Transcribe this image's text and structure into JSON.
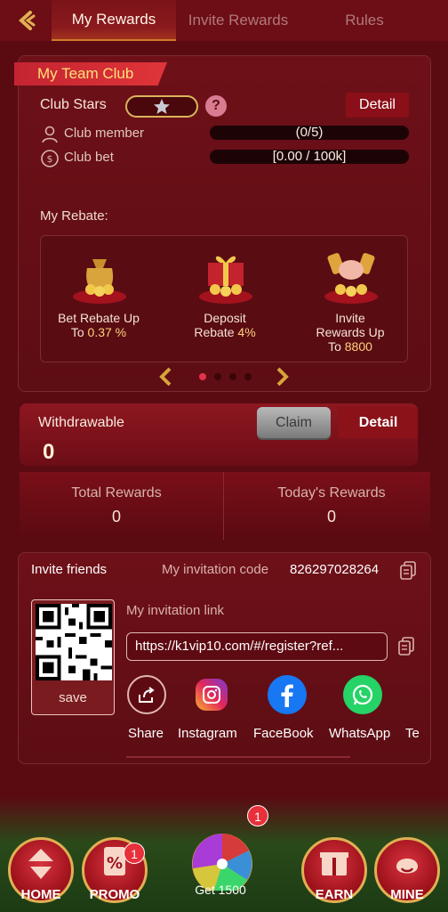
{
  "topnav": {
    "tabs": [
      {
        "label": "My Rewards"
      },
      {
        "label": "Invite Rewards"
      },
      {
        "label": "Rules"
      }
    ]
  },
  "club": {
    "banner": "My Team Club",
    "stars_label": "Club Stars",
    "detail_label": "Detail",
    "member_label": "Club member",
    "member_value": "(0/5)",
    "bet_label": "Club bet",
    "bet_value": "[0.00 / 100k]"
  },
  "rebate": {
    "title": "My Rebate:",
    "items": [
      {
        "line1": "Bet Rebate Up",
        "line2a": "To ",
        "line2b": "0.37 %"
      },
      {
        "line1": "Deposit",
        "line2a": "Rebate ",
        "line2b": "4%"
      },
      {
        "line1": "Invite",
        "line1b": "Rewards Up",
        "line2a": "To ",
        "line2b": "8800"
      }
    ],
    "pages": 4,
    "active_page": 1
  },
  "withdraw": {
    "label": "Withdrawable",
    "value": "0",
    "claim_label": "Claim",
    "detail_label": "Detail",
    "total_label": "Total Rewards",
    "total_value": "0",
    "today_label": "Today's Rewards",
    "today_value": "0"
  },
  "invite": {
    "title": "Invite friends",
    "code_label": "My invitation code",
    "code_value": "826297028264",
    "save_label": "save",
    "link_label": "My invitation link",
    "link_value": "https://k1vip10.com/#/register?ref...",
    "share": [
      {
        "label": "Share",
        "icon": "share-icon"
      },
      {
        "label": "Instagram",
        "icon": "instagram-icon"
      },
      {
        "label": "FaceBook",
        "icon": "facebook-icon"
      },
      {
        "label": "WhatsApp",
        "icon": "whatsapp-icon"
      },
      {
        "label": "Te",
        "icon": "telegram-icon"
      }
    ]
  },
  "bottomnav": {
    "home": "HOME",
    "promo": "PROMO",
    "promo_badge": "1",
    "get": "Get 1500",
    "get_badge": "1",
    "earn": "EARN",
    "mine": "MINE"
  }
}
